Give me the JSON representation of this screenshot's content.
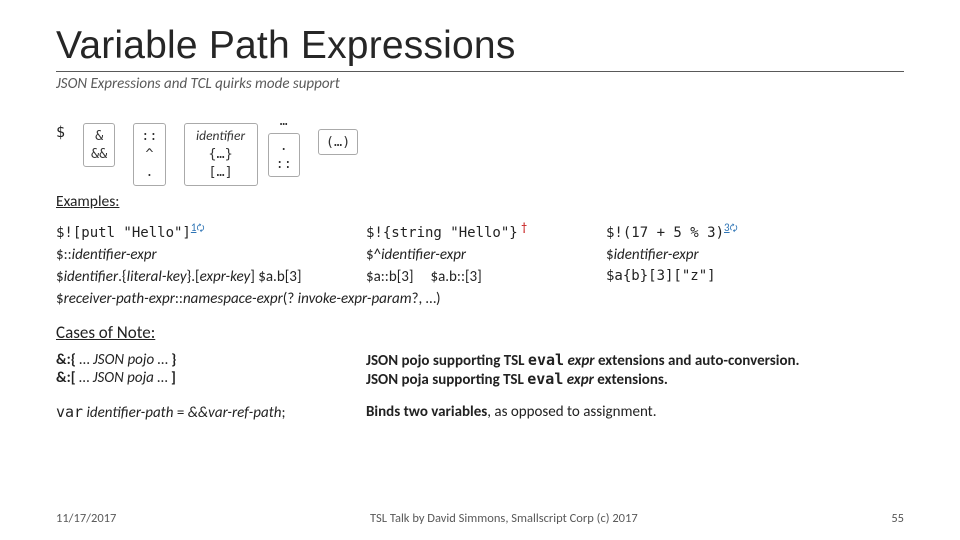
{
  "title": "Variable Path Expressions",
  "subtitle": "JSON Expressions and TCL quirks mode support",
  "syntax": {
    "dollar": "$",
    "col1": {
      "a": "&",
      "b": "&&"
    },
    "col2": {
      "a": "::",
      "b": "^",
      "c": "."
    },
    "col3": {
      "a": "identifier",
      "b": "{…}",
      "c": "[…]"
    },
    "dots_top": "…",
    "col4": {
      "a": ".",
      "b": "::"
    },
    "col5": "(…)"
  },
  "examples_label": "Examples:",
  "row1": {
    "a_code": "$![putl \"Hello\"]",
    "a_sup": "1",
    "b_code": "$!{string \"Hello\"}",
    "c_code": "$!(17 + 5 % 3)",
    "c_sup": "3"
  },
  "row2": {
    "a": "$::identifier-expr",
    "b": "$^identifier-expr",
    "c": "$identifier-expr"
  },
  "row3": {
    "a": "$identifier.{literal-key}.[expr-key] $a.b[3]",
    "b1": "$a::b[3]",
    "b2": "$a.b::[3]",
    "c": "$a{b}[3][\"z\"]"
  },
  "receiver_line": "$receiver-path-expr::namespace-expr(? invoke-expr-param?, …)",
  "cases_label": "Cases of Note:",
  "note1": {
    "left_a": "&:{ … JSON pojo … }",
    "left_b": "&:[ … JSON poja … ]",
    "right_a_pre": "JSON pojo supporting TSL ",
    "right_a_code": "eval",
    "right_a_post": " expr extensions and auto-conversion.",
    "right_b_pre": "JSON poja supporting TSL ",
    "right_b_code": "eval",
    "right_b_post": " expr extensions."
  },
  "note2": {
    "left_code": "var",
    "left_ital_a": " identifier-path",
    "left_eq": " = ",
    "left_ital_b": "&&var-ref-path",
    "left_semi": ";",
    "right_bold": "Binds two variables",
    "right_rest": ", as opposed to assignment."
  },
  "footer": {
    "left": "11/17/2017",
    "center": "TSL Talk by David Simmons, Smallscript Corp (c) 2017",
    "right": "55"
  },
  "icons": {
    "refresh": "🗘"
  }
}
